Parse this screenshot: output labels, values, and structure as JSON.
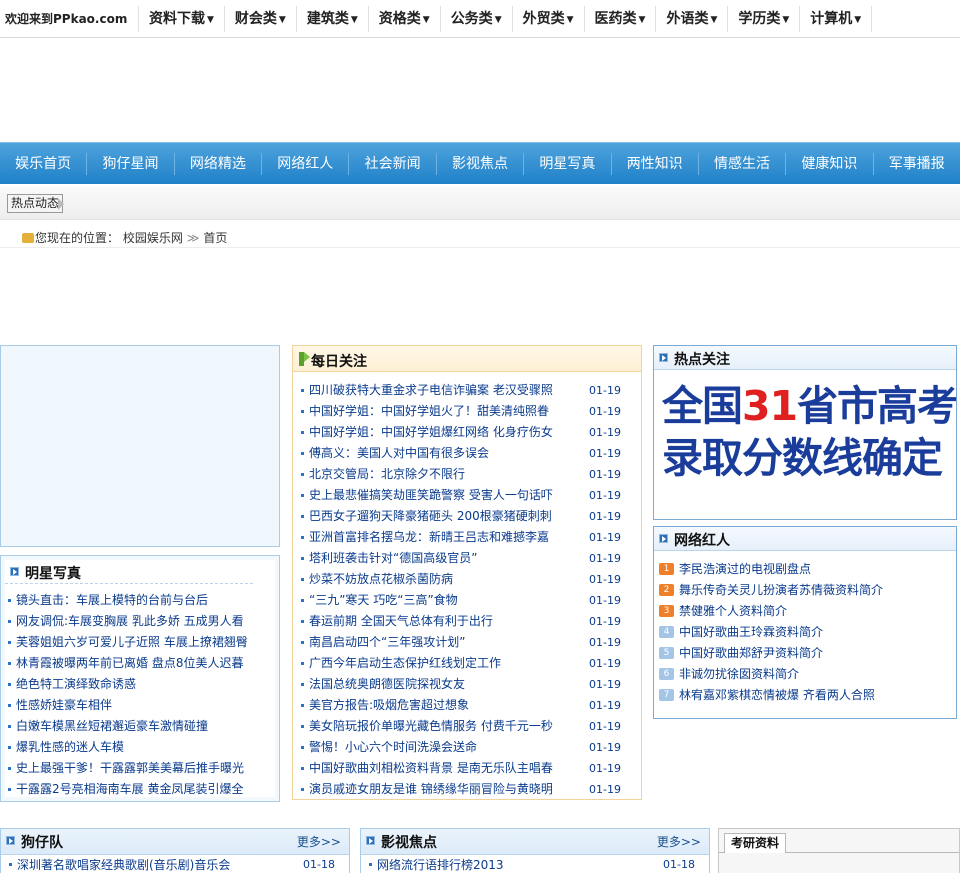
{
  "topnav": {
    "welcome": "欢迎来到PPkao.com",
    "items": [
      "资料下载",
      "财会类",
      "建筑类",
      "资格类",
      "公务类",
      "外贸类",
      "医药类",
      "外语类",
      "学历类",
      "计算机"
    ]
  },
  "bluenav": [
    "娱乐首页",
    "狗仔星闻",
    "网络精选",
    "网络红人",
    "社会新闻",
    "影视焦点",
    "明星写真",
    "两性知识",
    "情感生活",
    "健康知识",
    "军事播报"
  ],
  "hotbar": {
    "tag": "热点动态"
  },
  "breadcrumb": {
    "prefix": "您现在的位置：",
    "site": "校园娱乐网",
    "arrows": "≫",
    "current": "首页"
  },
  "daily": {
    "title": "每日关注",
    "items": [
      {
        "text": "四川破获特大重金求子电信诈骗案 老汉受骤照",
        "date": "01-19"
      },
      {
        "text": "中国好学姐：中国好学姐火了！甜美清纯照眷",
        "date": "01-19"
      },
      {
        "text": "中国好学姐：中国好学姐爆红网络 化身疗伤女",
        "date": "01-19"
      },
      {
        "text": "傅高义：美国人对中国有很多误会",
        "date": "01-19"
      },
      {
        "text": "北京交管局：北京除夕不限行",
        "date": "01-19"
      },
      {
        "text": "史上最悲催搞笑劫匪笑跪警察 受害人一句话吓",
        "date": "01-19"
      },
      {
        "text": "巴西女子遛狗天降豪猪砸头 200根豪猪硬刺刺",
        "date": "01-19"
      },
      {
        "text": "亚洲首富排名摆乌龙：新晴王吕志和难撼李嘉",
        "date": "01-19"
      },
      {
        "text": "塔利班袭击针对“德国高级官员”",
        "date": "01-19"
      },
      {
        "text": "炒菜不妨放点花椒杀菌防病",
        "date": "01-19"
      },
      {
        "text": "“三九”寒天 巧吃“三高”食物",
        "date": "01-19"
      },
      {
        "text": "春运前期 全国天气总体有利于出行",
        "date": "01-19"
      },
      {
        "text": "南昌启动四个“三年强攻计划”",
        "date": "01-19"
      },
      {
        "text": "广西今年启动生态保护红线划定工作",
        "date": "01-19"
      },
      {
        "text": "法国总统奥朗德医院探视女友",
        "date": "01-19"
      },
      {
        "text": "美官方报告:吸烟危害超过想象",
        "date": "01-19"
      },
      {
        "text": "美女陪玩报价单曝光藏色情服务 付费千元一秒",
        "date": "01-19"
      },
      {
        "text": "警惕！小心六个时间洗澡会送命",
        "date": "01-19"
      },
      {
        "text": "中国好歌曲刘相松资料背景 是南无乐队主唱春",
        "date": "01-19"
      },
      {
        "text": "演员戚迹女朋友是谁 锦绣缘华丽冒险与黄晓明",
        "date": "01-19"
      }
    ]
  },
  "hotfocus": {
    "title": "热点关注",
    "promo_line1_a": "全国",
    "promo_line1_num": "31",
    "promo_line1_b": "省市高考",
    "promo_line2": "录取分数线确定"
  },
  "netstars": {
    "title": "网络红人",
    "items": [
      {
        "num": "1",
        "text": "李民浩演过的电视剧盘点",
        "hot": true
      },
      {
        "num": "2",
        "text": "舞乐传奇关灵儿扮演者苏倩薇资料简介",
        "hot": true
      },
      {
        "num": "3",
        "text": "禁健雅个人资料简介",
        "hot": true
      },
      {
        "num": "4",
        "text": "中国好歌曲王玲霖资料简介",
        "hot": false
      },
      {
        "num": "5",
        "text": "中国好歌曲郑舒尹资料简介",
        "hot": false
      },
      {
        "num": "6",
        "text": "非诚勿扰徐囡资料简介",
        "hot": false
      },
      {
        "num": "7",
        "text": "林宥嘉邓紫棋恋情被爆 齐看两人合照",
        "hot": false
      }
    ]
  },
  "starphotos": {
    "title": "明星写真",
    "items": [
      "镜头直击：车展上模特的台前与台后",
      "网友调侃:车展变胸展 乳此多娇 五成男人看",
      "芙蓉姐姐六岁可爱儿子近照 车展上撩裙翘臀",
      "林青霞被曝两年前已离婚 盘点8位美人迟暮",
      "绝色特工演绎致命诱惑",
      "性感娇娃豪车相伴",
      "白嫩车模黑丝短裙邂逅豪车激情碰撞",
      "爆乳性感的迷人车模",
      "史上最强干爹！干露露郭美美幕后推手曝光",
      "干露露2号亮相海南车展 黄金凤尾装引爆全"
    ]
  },
  "paparazzi": {
    "title": "狗仔队",
    "more": "更多>>",
    "items": [
      {
        "text": "深圳著名歌唱家经典歌剧(音乐剧)音乐会",
        "date": "01-18"
      }
    ]
  },
  "filmfocus": {
    "title": "影视焦点",
    "more": "更多>>",
    "items": [
      {
        "text": "网络流行语排行榜2013",
        "date": "01-18"
      }
    ]
  },
  "kaoyan": {
    "tab": "考研资料"
  }
}
